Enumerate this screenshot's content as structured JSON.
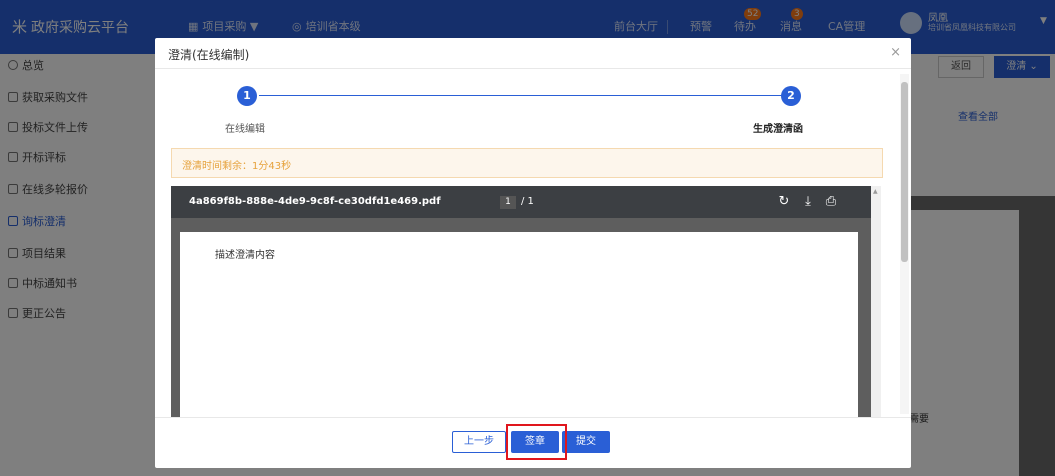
{
  "app": {
    "title": "政府采购云平台",
    "logo_glyph": "米"
  },
  "topbar": {
    "project_menu": "项目采购 ▼",
    "location": "培训省本级",
    "front_hall": "前台大厅",
    "warning": "预警",
    "todo": "待办",
    "todo_count": "52",
    "messages": "消息",
    "messages_count": "3",
    "ca": "CA管理",
    "user_name": "凤凰",
    "user_org": "培训省凤凰科技有限公司"
  },
  "sidebar": {
    "items": [
      {
        "label": "总览"
      },
      {
        "label": "获取采购文件"
      },
      {
        "label": "投标文件上传"
      },
      {
        "label": "开标评标"
      },
      {
        "label": "在线多轮报价"
      },
      {
        "label": "询标澄清"
      },
      {
        "label": "项目结果"
      },
      {
        "label": "中标通知书"
      },
      {
        "label": "更正公告"
      }
    ],
    "active_index": 5
  },
  "background": {
    "back_label": "返回",
    "clarify_label": "澄清 ⌄",
    "view_all": "查看全部",
    "note": "▾需要"
  },
  "dialog": {
    "title": "澄清(在线编制)",
    "close_glyph": "×",
    "steps": [
      {
        "number": "1",
        "label": "在线编辑"
      },
      {
        "number": "2",
        "label": "生成澄清函"
      }
    ],
    "timer_text": "澄清时间剩余：1分43秒",
    "pdf": {
      "filename": "4a869f8b-888e-4de9-9c8f-ce30dfd1e469.pdf",
      "page_current": "1",
      "page_total": "/ 1",
      "content": "描述澄清内容"
    },
    "buttons": {
      "prev": "上一步",
      "sign": "签章",
      "submit": "提交"
    }
  },
  "colors": {
    "primary": "#2a5fd6",
    "highlight": "#e0161d",
    "warning_text": "#e6a23c"
  }
}
